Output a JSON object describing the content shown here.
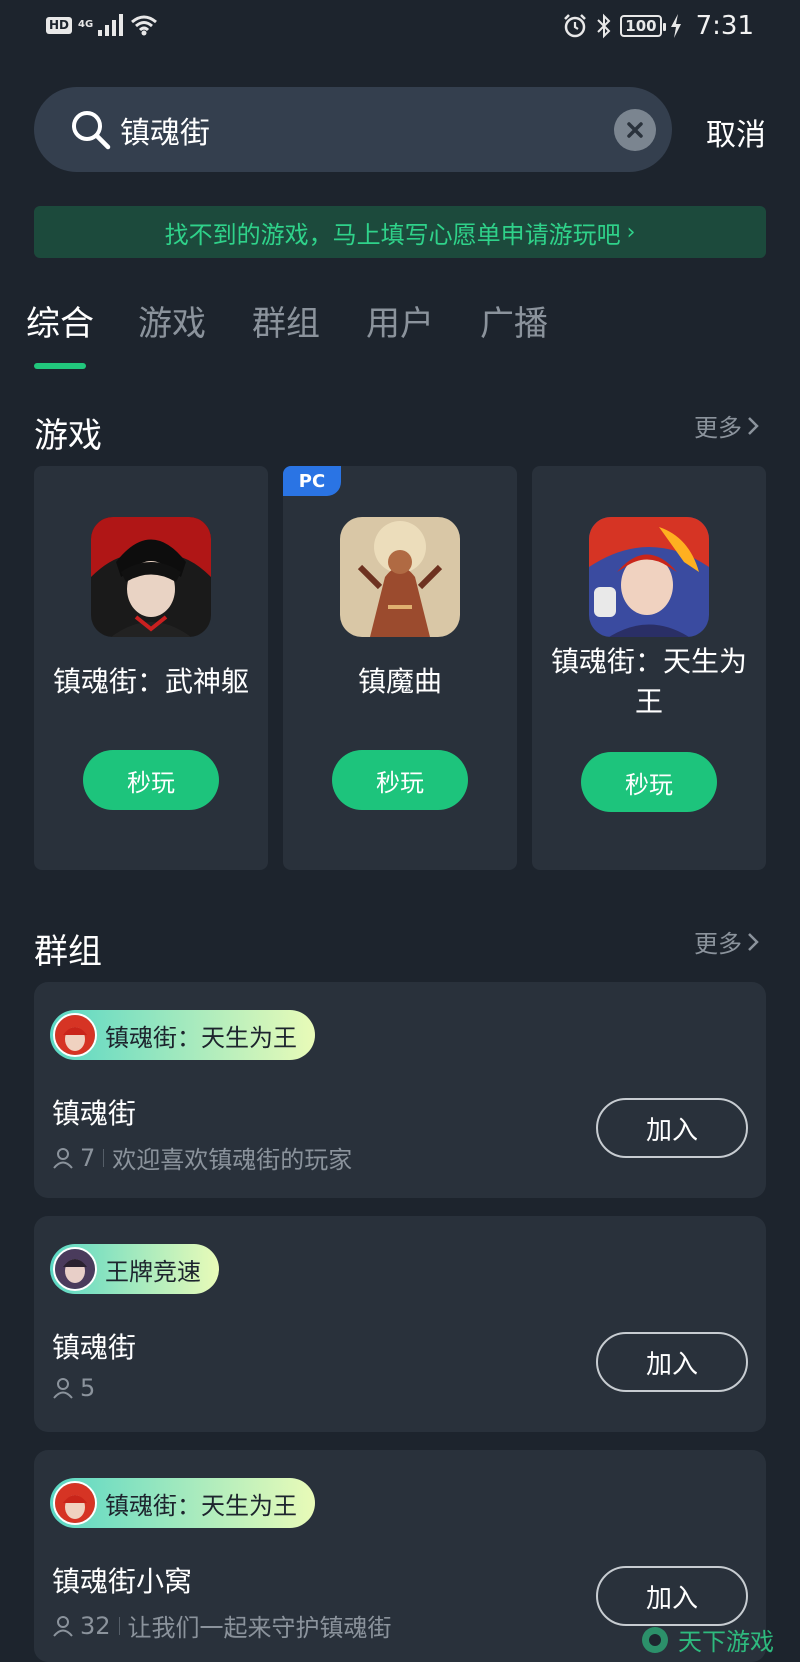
{
  "status_bar": {
    "hd": "HD",
    "network": "4G",
    "battery": "100",
    "time": "7:31"
  },
  "search": {
    "query": "镇魂街",
    "cancel_label": "取消"
  },
  "wish_banner": {
    "text": "找不到的游戏，马上填写心愿单申请游玩吧",
    "chevron": "›"
  },
  "tabs": [
    {
      "label": "综合",
      "active": true
    },
    {
      "label": "游戏",
      "active": false
    },
    {
      "label": "群组",
      "active": false
    },
    {
      "label": "用户",
      "active": false
    },
    {
      "label": "广播",
      "active": false
    }
  ],
  "games_section": {
    "title": "游戏",
    "more_label": "更多",
    "items": [
      {
        "name": "镇魂街：武神躯",
        "play_label": "秒玩",
        "pc_tag": ""
      },
      {
        "name": "镇魔曲",
        "play_label": "秒玩",
        "pc_tag": "PC"
      },
      {
        "name": "镇魂街：天生为王",
        "play_label": "秒玩",
        "pc_tag": ""
      }
    ]
  },
  "groups_section": {
    "title": "群组",
    "more_label": "更多",
    "items": [
      {
        "tag": "镇魂街：天生为王",
        "name": "镇魂街",
        "members": "7",
        "description": "欢迎喜欢镇魂街的玩家",
        "join_label": "加入"
      },
      {
        "tag": "王牌竞速",
        "name": "镇魂街",
        "members": "5",
        "description": "",
        "join_label": "加入"
      },
      {
        "tag": "镇魂街：天生为王",
        "name": "镇魂街小窝",
        "members": "32",
        "description": "让我们一起来守护镇魂街",
        "join_label": "加入"
      }
    ]
  },
  "watermark": "天下游戏",
  "colors": {
    "background": "#1d242d",
    "card": "#29313b",
    "accent_green": "#1dc47c",
    "banner_text": "#2fd28a",
    "pc_tag": "#2a74e4"
  }
}
